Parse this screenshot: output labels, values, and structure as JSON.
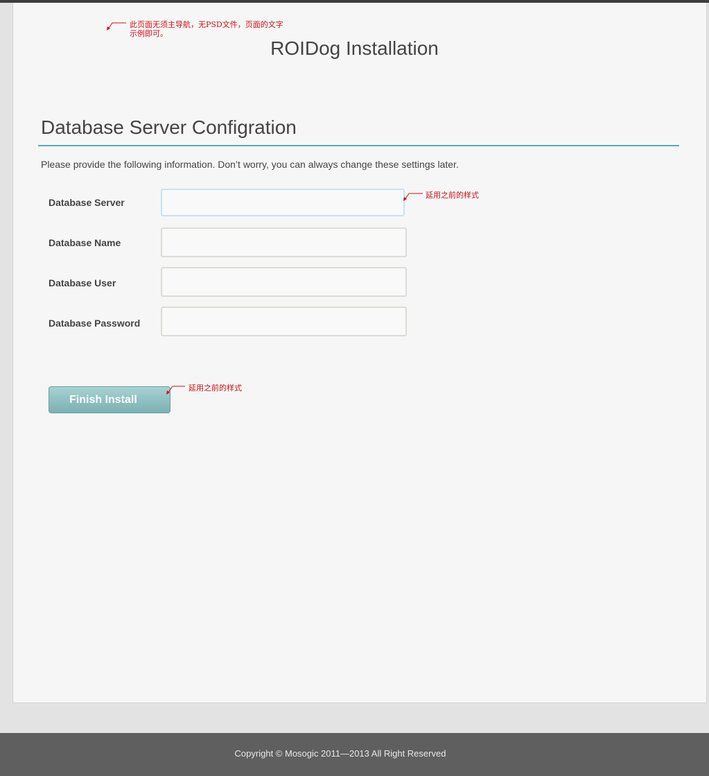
{
  "annotations": {
    "page_note": "此页面无须主导航，无PSD文件，页面的文字示例即可。",
    "input_note": "延用之前的样式",
    "button_note": "延用之前的样式"
  },
  "header": {
    "title": "ROIDog Installation"
  },
  "section": {
    "title": "Database Server Configration",
    "intro": "Please provide the following information. Don’t worry, you can always change these settings later."
  },
  "form": {
    "fields": [
      {
        "label": "Database Server",
        "value": ""
      },
      {
        "label": "Database Name",
        "value": ""
      },
      {
        "label": "Database User",
        "value": ""
      },
      {
        "label": "Database Password",
        "value": ""
      }
    ],
    "submit_label": "Finish Install"
  },
  "footer": {
    "copyright": "Copyright © Mosogic 2011—2013 All Right Reserved"
  },
  "colors": {
    "accent_rule": "#5aaab9",
    "annotation": "#cc1111",
    "button": "#8ebfc1",
    "footer_bg": "#5f5f5f"
  }
}
